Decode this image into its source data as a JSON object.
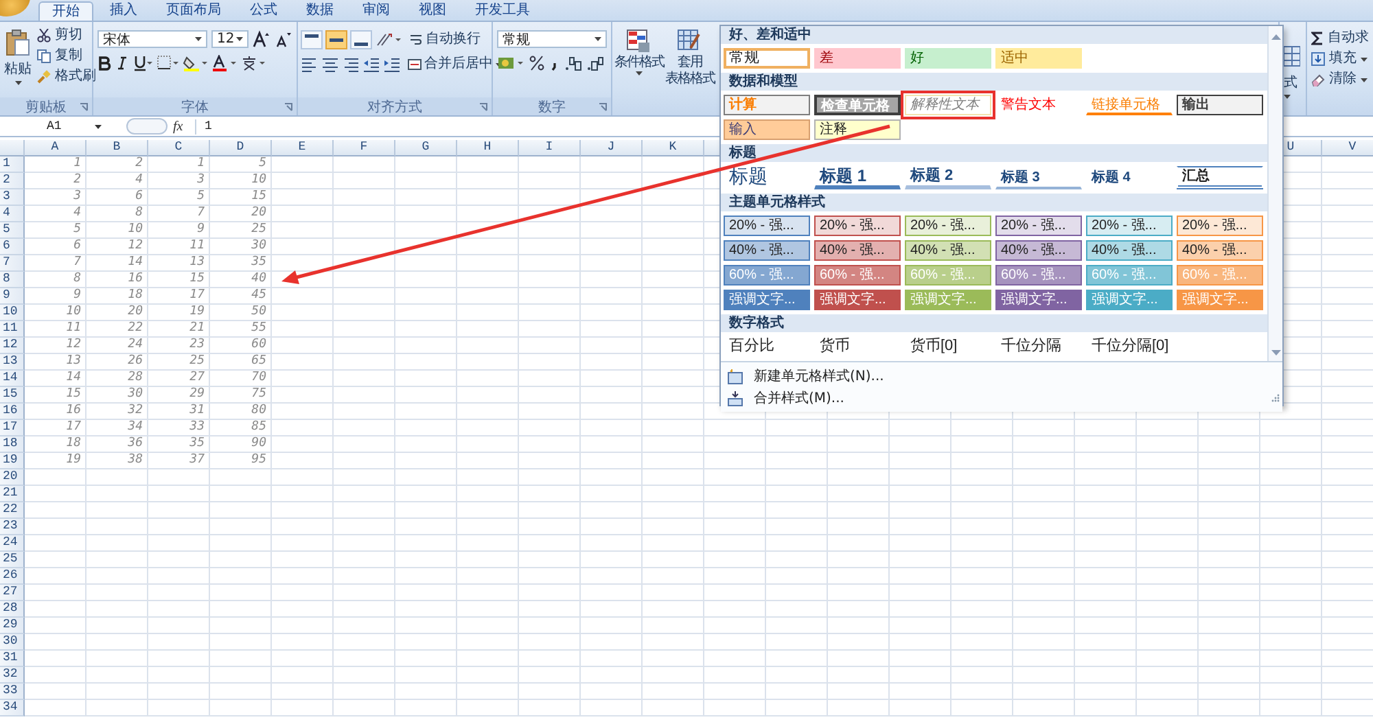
{
  "tabs": [
    {
      "label": "开始",
      "selected": true
    },
    {
      "label": "插入",
      "selected": false
    },
    {
      "label": "页面布局",
      "selected": false
    },
    {
      "label": "公式",
      "selected": false
    },
    {
      "label": "数据",
      "selected": false
    },
    {
      "label": "审阅",
      "selected": false
    },
    {
      "label": "视图",
      "selected": false
    },
    {
      "label": "开发工具",
      "selected": false
    }
  ],
  "ribbon": {
    "clipboard": {
      "label": "剪贴板",
      "paste": "粘贴",
      "cut": "剪切",
      "copy": "复制",
      "format_painter": "格式刷"
    },
    "font": {
      "label": "字体",
      "font_name": "宋体",
      "font_size": "12"
    },
    "alignment": {
      "label": "对齐方式",
      "wrap_text": "自动换行",
      "merge_center": "合并后居中",
      "vertical_align": [
        {
          "selected": false
        },
        {
          "selected": true
        },
        {
          "selected": false
        }
      ]
    },
    "number": {
      "label": "数字",
      "format": "常规"
    },
    "styles": {
      "conditional_format": "条件格式",
      "table_format": [
        "套用",
        "表格格式"
      ],
      "cell_format_partial": "式"
    },
    "editing": {
      "autosum": "自动求",
      "fill": "填充",
      "clear": "清除"
    }
  },
  "formula_bar": {
    "name_box": "A1",
    "function_label": "fx",
    "formula": "1"
  },
  "sheet": {
    "columns_left": [
      "A",
      "B",
      "C",
      "D",
      "E",
      "F",
      "G",
      "H",
      "I",
      "J",
      "K"
    ],
    "columns_right": [
      "U",
      "V"
    ],
    "rows": [
      {
        "header": "1",
        "cells": [
          "1",
          "2",
          "1",
          "5"
        ]
      },
      {
        "header": "2",
        "cells": [
          "2",
          "4",
          "3",
          "10"
        ]
      },
      {
        "header": "3",
        "cells": [
          "3",
          "6",
          "5",
          "15"
        ]
      },
      {
        "header": "4",
        "cells": [
          "4",
          "8",
          "7",
          "20"
        ]
      },
      {
        "header": "5",
        "cells": [
          "5",
          "10",
          "9",
          "25"
        ]
      },
      {
        "header": "6",
        "cells": [
          "6",
          "12",
          "11",
          "30"
        ]
      },
      {
        "header": "7",
        "cells": [
          "7",
          "14",
          "13",
          "35"
        ]
      },
      {
        "header": "8",
        "cells": [
          "8",
          "16",
          "15",
          "40"
        ]
      },
      {
        "header": "9",
        "cells": [
          "9",
          "18",
          "17",
          "45"
        ]
      },
      {
        "header": "10",
        "cells": [
          "10",
          "20",
          "19",
          "50"
        ]
      },
      {
        "header": "11",
        "cells": [
          "11",
          "22",
          "21",
          "55"
        ]
      },
      {
        "header": "12",
        "cells": [
          "12",
          "24",
          "23",
          "60"
        ]
      },
      {
        "header": "13",
        "cells": [
          "13",
          "26",
          "25",
          "65"
        ]
      },
      {
        "header": "14",
        "cells": [
          "14",
          "28",
          "27",
          "70"
        ]
      },
      {
        "header": "15",
        "cells": [
          "15",
          "30",
          "29",
          "75"
        ]
      },
      {
        "header": "16",
        "cells": [
          "16",
          "32",
          "31",
          "80"
        ]
      },
      {
        "header": "17",
        "cells": [
          "17",
          "34",
          "33",
          "85"
        ]
      },
      {
        "header": "18",
        "cells": [
          "18",
          "36",
          "35",
          "90"
        ]
      },
      {
        "header": "19",
        "cells": [
          "19",
          "38",
          "37",
          "95"
        ]
      },
      {
        "header": "20"
      },
      {
        "header": "21"
      },
      {
        "header": "22"
      },
      {
        "header": "23"
      },
      {
        "header": "24"
      },
      {
        "header": "25"
      },
      {
        "header": "26"
      },
      {
        "header": "27"
      },
      {
        "header": "28"
      },
      {
        "header": "29"
      },
      {
        "header": "30"
      },
      {
        "header": "31"
      },
      {
        "header": "32"
      },
      {
        "header": "33"
      },
      {
        "header": "34"
      }
    ]
  },
  "style_gallery": {
    "sections": [
      {
        "title": "好、差和适中",
        "tiles": [
          {
            "label": "常规",
            "kind": "normal",
            "selected": true
          },
          {
            "label": "差",
            "kind": "bad",
            "selected": false
          },
          {
            "label": "好",
            "kind": "good",
            "selected": false
          },
          {
            "label": "适中",
            "kind": "neutral",
            "selected": false
          }
        ]
      },
      {
        "title": "数据和模型",
        "tiles": [
          {
            "label": "计算",
            "kind": "calculation",
            "selected": false,
            "highlighted": false
          },
          {
            "label": "检查单元格",
            "kind": "check",
            "selected": false,
            "highlighted": false
          },
          {
            "label": "解释性文本",
            "kind": "explanatory",
            "selected": false,
            "highlighted": true
          },
          {
            "label": "警告文本",
            "kind": "warning",
            "selected": false,
            "highlighted": false
          },
          {
            "label": "链接单元格",
            "kind": "linked",
            "selected": false,
            "highlighted": false
          },
          {
            "label": "输出",
            "kind": "output",
            "selected": false,
            "highlighted": false
          },
          {
            "label": "输入",
            "kind": "input",
            "selected": false,
            "highlighted": false
          },
          {
            "label": "注释",
            "kind": "note",
            "selected": false,
            "highlighted": false
          }
        ]
      },
      {
        "title": "标题",
        "tiles": [
          {
            "label": "标题",
            "kind": "title",
            "selected": false
          },
          {
            "label": "标题 1",
            "kind": "heading1",
            "selected": false
          },
          {
            "label": "标题 2",
            "kind": "heading2",
            "selected": false
          },
          {
            "label": "标题 3",
            "kind": "heading3",
            "selected": false
          },
          {
            "label": "标题 4",
            "kind": "heading4",
            "selected": false
          },
          {
            "label": "汇总",
            "kind": "total",
            "selected": false
          }
        ]
      },
      {
        "title": "主题单元格样式",
        "tiles": [
          {
            "label": "20% - 强...",
            "kind": "tint20",
            "color": "#4f81bd",
            "selected": false
          },
          {
            "label": "20% - 强...",
            "kind": "tint20",
            "color": "#c0504d",
            "selected": false
          },
          {
            "label": "20% - 强...",
            "kind": "tint20",
            "color": "#9bbb59",
            "selected": false
          },
          {
            "label": "20% - 强...",
            "kind": "tint20",
            "color": "#8064a2",
            "selected": false
          },
          {
            "label": "20% - 强...",
            "kind": "tint20",
            "color": "#4bacc6",
            "selected": false
          },
          {
            "label": "20% - 强...",
            "kind": "tint20",
            "color": "#f79646",
            "selected": false
          },
          {
            "label": "40% - 强...",
            "kind": "tint40",
            "color": "#4f81bd",
            "selected": false
          },
          {
            "label": "40% - 强...",
            "kind": "tint40",
            "color": "#c0504d",
            "selected": false
          },
          {
            "label": "40% - 强...",
            "kind": "tint40",
            "color": "#9bbb59",
            "selected": false
          },
          {
            "label": "40% - 强...",
            "kind": "tint40",
            "color": "#8064a2",
            "selected": false
          },
          {
            "label": "40% - 强...",
            "kind": "tint40",
            "color": "#4bacc6",
            "selected": false
          },
          {
            "label": "40% - 强...",
            "kind": "tint40",
            "color": "#f79646",
            "selected": false
          },
          {
            "label": "60% - 强...",
            "kind": "tint60",
            "color": "#4f81bd",
            "selected": false
          },
          {
            "label": "60% - 强...",
            "kind": "tint60",
            "color": "#c0504d",
            "selected": false
          },
          {
            "label": "60% - 强...",
            "kind": "tint60",
            "color": "#9bbb59",
            "selected": false
          },
          {
            "label": "60% - 强...",
            "kind": "tint60",
            "color": "#8064a2",
            "selected": false
          },
          {
            "label": "60% - 强...",
            "kind": "tint60",
            "color": "#4bacc6",
            "selected": false
          },
          {
            "label": "60% - 强...",
            "kind": "tint60",
            "color": "#f79646",
            "selected": false
          },
          {
            "label": "强调文字...",
            "kind": "accent",
            "color": "#4f81bd",
            "selected": false
          },
          {
            "label": "强调文字...",
            "kind": "accent",
            "color": "#c0504d",
            "selected": false
          },
          {
            "label": "强调文字...",
            "kind": "accent",
            "color": "#9bbb59",
            "selected": false
          },
          {
            "label": "强调文字...",
            "kind": "accent",
            "color": "#8064a2",
            "selected": false
          },
          {
            "label": "强调文字...",
            "kind": "accent",
            "color": "#4bacc6",
            "selected": false
          },
          {
            "label": "强调文字...",
            "kind": "accent",
            "color": "#f79646",
            "selected": false
          }
        ]
      },
      {
        "title": "数字格式",
        "tiles": [
          {
            "label": "百分比",
            "kind": "numfmt",
            "selected": false
          },
          {
            "label": "货币",
            "kind": "numfmt",
            "selected": false
          },
          {
            "label": "货币[0]",
            "kind": "numfmt",
            "selected": false
          },
          {
            "label": "千位分隔",
            "kind": "numfmt",
            "selected": false
          },
          {
            "label": "千位分隔[0]",
            "kind": "numfmt",
            "selected": false
          }
        ]
      }
    ],
    "menu": [
      {
        "label": "新建单元格样式(N)...",
        "kind": "new"
      },
      {
        "label": "合并样式(M)...",
        "kind": "merge"
      }
    ]
  }
}
